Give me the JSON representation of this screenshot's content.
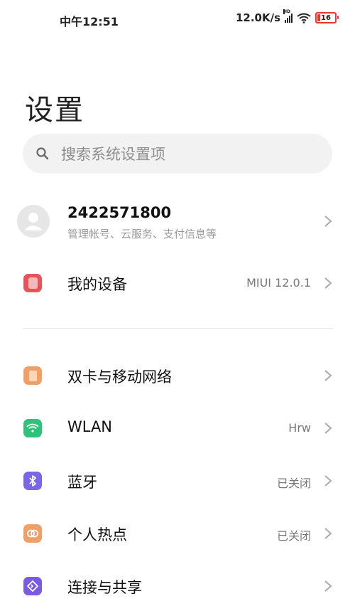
{
  "status_bar": {
    "time": "中午12:51",
    "network_speed": "12.0K/s",
    "hd_label": "HD",
    "battery": "16"
  },
  "page": {
    "title": "设置"
  },
  "search": {
    "placeholder": "搜索系统设置项"
  },
  "account": {
    "id": "2422571800",
    "subtitle": "管理帐号、云服务、支付信息等"
  },
  "device": {
    "label": "我的设备",
    "value": "MIUI 12.0.1",
    "icon_color": "#e8525a"
  },
  "items": [
    {
      "label": "双卡与移动网络",
      "value": "",
      "icon": "sim-card-icon",
      "color": "#f0a066"
    },
    {
      "label": "WLAN",
      "value": "Hrw",
      "icon": "wifi-icon",
      "color": "#2fc27a"
    },
    {
      "label": "蓝牙",
      "value": "已关闭",
      "icon": "bluetooth-icon",
      "color": "#7a66e6"
    },
    {
      "label": "个人热点",
      "value": "已关闭",
      "icon": "hotspot-icon",
      "color": "#f0a066"
    },
    {
      "label": "连接与共享",
      "value": "",
      "icon": "share-icon",
      "color": "#7a5ae0"
    }
  ]
}
